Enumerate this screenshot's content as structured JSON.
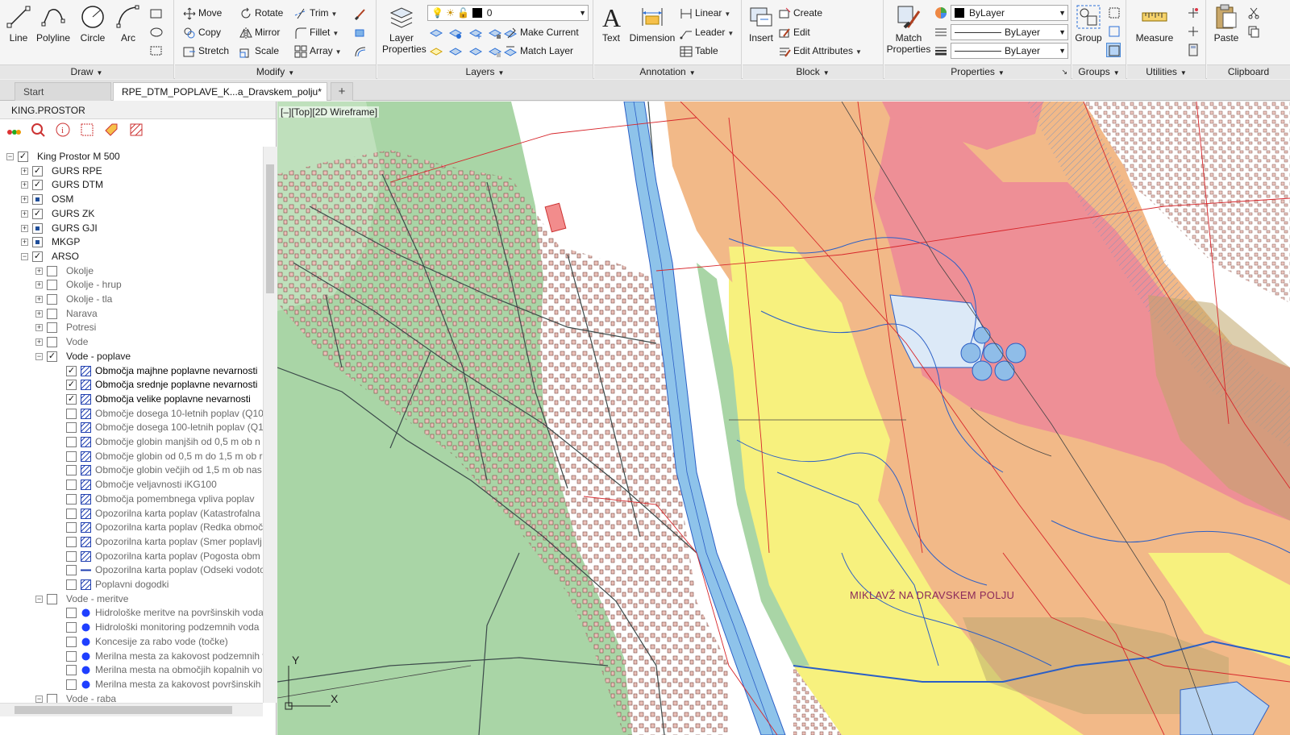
{
  "ribbon": {
    "draw": {
      "title": "Draw",
      "line": "Line",
      "polyline": "Polyline",
      "circle": "Circle",
      "arc": "Arc"
    },
    "modify": {
      "title": "Modify",
      "move": "Move",
      "rotate": "Rotate",
      "trim": "Trim",
      "copy": "Copy",
      "mirror": "Mirror",
      "fillet": "Fillet",
      "stretch": "Stretch",
      "scale": "Scale",
      "array": "Array"
    },
    "layers": {
      "title": "Layers",
      "layer_properties": "Layer Properties",
      "current_layer": "0",
      "make_current": "Make Current",
      "match_layer": "Match Layer"
    },
    "annotation": {
      "title": "Annotation",
      "text": "Text",
      "dimension": "Dimension",
      "linear": "Linear",
      "leader": "Leader",
      "table": "Table"
    },
    "block": {
      "title": "Block",
      "insert": "Insert",
      "create": "Create",
      "edit": "Edit",
      "edit_attributes": "Edit Attributes"
    },
    "properties": {
      "title": "Properties",
      "match_properties": "Match Properties",
      "color": "ByLayer",
      "linetype": "ByLayer",
      "lineweight": "ByLayer"
    },
    "groups": {
      "title": "Groups",
      "group": "Group"
    },
    "utilities": {
      "title": "Utilities",
      "measure": "Measure"
    },
    "clipboard": {
      "title": "Clipboard",
      "paste": "Paste"
    }
  },
  "tabs": [
    {
      "label": "Start"
    },
    {
      "label": "RPE_DTM_POPLAVE_K...a_Dravskem_polju*"
    }
  ],
  "panel": {
    "title": "KING.PROSTOR",
    "tree": [
      {
        "label": "King Prostor M 500",
        "level": 0,
        "state": "checked",
        "expander": "-"
      },
      {
        "label": "GURS RPE",
        "level": 1,
        "state": "checked",
        "expander": "+"
      },
      {
        "label": "GURS DTM",
        "level": 1,
        "state": "checked",
        "expander": "+"
      },
      {
        "label": "OSM",
        "level": 1,
        "state": "partial",
        "expander": "+"
      },
      {
        "label": "GURS ZK",
        "level": 1,
        "state": "checked",
        "expander": "+"
      },
      {
        "label": "GURS GJI",
        "level": 1,
        "state": "partial",
        "expander": "+"
      },
      {
        "label": "MKGP",
        "level": 1,
        "state": "partial",
        "expander": "+"
      },
      {
        "label": "ARSO",
        "level": 1,
        "state": "checked",
        "expander": "-"
      },
      {
        "label": "Okolje",
        "level": 2,
        "state": "empty",
        "expander": "+",
        "dim": true
      },
      {
        "label": "Okolje - hrup",
        "level": 2,
        "state": "empty",
        "expander": "+",
        "dim": true
      },
      {
        "label": "Okolje - tla",
        "level": 2,
        "state": "empty",
        "expander": "+",
        "dim": true
      },
      {
        "label": "Narava",
        "level": 2,
        "state": "empty",
        "expander": "+",
        "dim": true
      },
      {
        "label": "Potresi",
        "level": 2,
        "state": "empty",
        "expander": "+",
        "dim": true
      },
      {
        "label": "Vode",
        "level": 2,
        "state": "empty",
        "expander": "+",
        "dim": true
      },
      {
        "label": "Vode - poplave",
        "level": 2,
        "state": "checked",
        "expander": "-"
      },
      {
        "label": "Območja majhne poplavne nevarnosti",
        "level": 3,
        "state": "checked",
        "icon": "hatch",
        "bold": true
      },
      {
        "label": "Območja srednje poplavne nevarnosti",
        "level": 3,
        "state": "checked",
        "icon": "hatch",
        "bold": true
      },
      {
        "label": "Območja velike poplavne nevarnosti",
        "level": 3,
        "state": "checked",
        "icon": "hatch",
        "bold": true
      },
      {
        "label": "Območje dosega 10-letnih poplav (Q10",
        "level": 3,
        "state": "empty",
        "icon": "hatch",
        "dim": true
      },
      {
        "label": "Območje dosega 100-letnih poplav (Q1",
        "level": 3,
        "state": "empty",
        "icon": "hatch",
        "dim": true
      },
      {
        "label": "Območje globin manjših od 0,5 m ob n",
        "level": 3,
        "state": "empty",
        "icon": "hatch",
        "dim": true
      },
      {
        "label": "Območje globin od 0,5 m do 1,5 m ob r",
        "level": 3,
        "state": "empty",
        "icon": "hatch",
        "dim": true
      },
      {
        "label": "Območje globin večjih od 1,5 m ob nas",
        "level": 3,
        "state": "empty",
        "icon": "hatch",
        "dim": true
      },
      {
        "label": "Območje veljavnosti iKG100",
        "level": 3,
        "state": "empty",
        "icon": "hatch",
        "dim": true
      },
      {
        "label": "Območja pomembnega vpliva poplav",
        "level": 3,
        "state": "empty",
        "icon": "hatch",
        "dim": true
      },
      {
        "label": "Opozorilna karta poplav (Katastrofalna",
        "level": 3,
        "state": "empty",
        "icon": "hatch",
        "dim": true
      },
      {
        "label": "Opozorilna karta poplav (Redka območ",
        "level": 3,
        "state": "empty",
        "icon": "hatch",
        "dim": true
      },
      {
        "label": "Opozorilna karta poplav (Smer poplavlj",
        "level": 3,
        "state": "empty",
        "icon": "hatch",
        "dim": true
      },
      {
        "label": "Opozorilna karta poplav (Pogosta obm",
        "level": 3,
        "state": "empty",
        "icon": "hatch",
        "dim": true
      },
      {
        "label": "Opozorilna karta poplav (Odseki vodoto",
        "level": 3,
        "state": "empty",
        "icon": "line",
        "dim": true
      },
      {
        "label": "Poplavni dogodki",
        "level": 3,
        "state": "empty",
        "icon": "hatch",
        "dim": true
      },
      {
        "label": "Vode - meritve",
        "level": 2,
        "state": "empty",
        "expander": "-",
        "dim": true
      },
      {
        "label": "Hidrološke meritve na površinskih voda",
        "level": 3,
        "state": "empty",
        "icon": "dot",
        "dim": true
      },
      {
        "label": "Hidrološki monitoring podzemnih voda",
        "level": 3,
        "state": "empty",
        "icon": "dot",
        "dim": true
      },
      {
        "label": "Koncesije za rabo vode (točke)",
        "level": 3,
        "state": "empty",
        "icon": "dot",
        "dim": true
      },
      {
        "label": "Merilna mesta za kakovost podzemnih v",
        "level": 3,
        "state": "empty",
        "icon": "dot",
        "dim": true
      },
      {
        "label": "Merilna mesta na območjih kopalnih vo",
        "level": 3,
        "state": "empty",
        "icon": "dot",
        "dim": true
      },
      {
        "label": "Merilna mesta za kakovost površinskih v",
        "level": 3,
        "state": "empty",
        "icon": "dot",
        "dim": true
      },
      {
        "label": "Vode - raba",
        "level": 2,
        "state": "empty",
        "expander": "-",
        "dim": true
      }
    ]
  },
  "viewport": {
    "label": "[–][Top][2D Wireframe]",
    "place_name": "MIKLAVŽ NA DRAVSKEM POLJU",
    "axis_y": "Y",
    "axis_x": "X"
  },
  "colors": {
    "forest": "#a8d4a5",
    "river": "#7bb7e3",
    "flood_low": "#f7f17e",
    "flood_mid": "#f2b988",
    "flood_high": "#ee8f96",
    "outline_blue": "#2b5fc6",
    "parcel_red": "#d7262b",
    "building": "#e9b8b0"
  }
}
